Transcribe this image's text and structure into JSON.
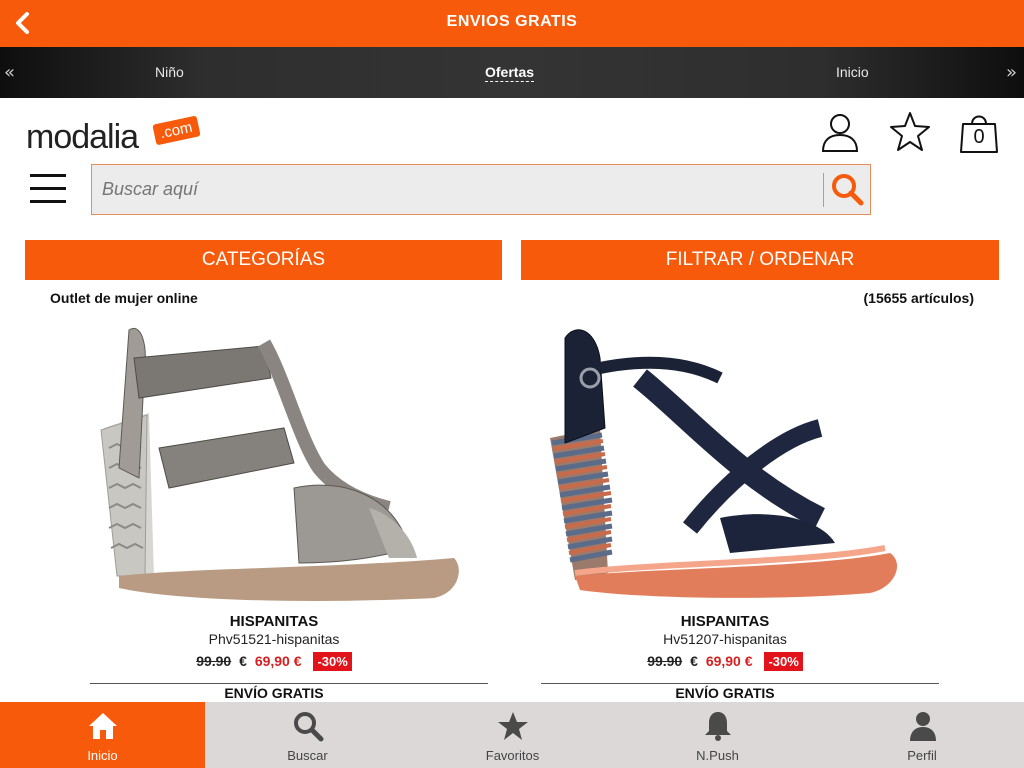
{
  "topbar": {
    "title": "ENVIOS GRATIS"
  },
  "nav": {
    "prev_icon": "double-chevron-left-icon",
    "next_icon": "double-chevron-right-icon",
    "items": [
      {
        "label": "Niño"
      },
      {
        "label": "Ofertas",
        "active": true
      },
      {
        "label": "Inicio"
      }
    ]
  },
  "header": {
    "logo_word": "modalia",
    "logo_suffix": ".com",
    "cart_count": "0"
  },
  "search": {
    "placeholder": "Buscar aquí"
  },
  "buttons": {
    "categories": "CATEGORÍAS",
    "filter": "FILTRAR / ORDENAR"
  },
  "listing": {
    "title": "Outlet de mujer online",
    "count": "(15655 artículos)"
  },
  "products": [
    {
      "brand": "HISPANITAS",
      "ref": "Phv51521-hispanitas",
      "old_price": "99.90",
      "currency": "€",
      "new_price": "69,90",
      "new_currency": "€",
      "discount": "-30%",
      "shipping": "ENVÍO GRATIS"
    },
    {
      "brand": "HISPANITAS",
      "ref": "Hv51207-hispanitas",
      "old_price": "99.90",
      "currency": "€",
      "new_price": "69,90",
      "new_currency": "€",
      "discount": "-30%",
      "shipping": "ENVÍO GRATIS"
    }
  ],
  "tabs": [
    {
      "label": "Inicio",
      "icon": "home-icon",
      "active": true
    },
    {
      "label": "Buscar",
      "icon": "search-icon"
    },
    {
      "label": "Favoritos",
      "icon": "star-icon"
    },
    {
      "label": "N.Push",
      "icon": "bell-icon"
    },
    {
      "label": "Perfil",
      "icon": "user-icon"
    }
  ],
  "colors": {
    "accent": "#f75a0a",
    "discount": "#e2131b",
    "price": "#d62020",
    "tabbar": "#dcd8d8"
  }
}
